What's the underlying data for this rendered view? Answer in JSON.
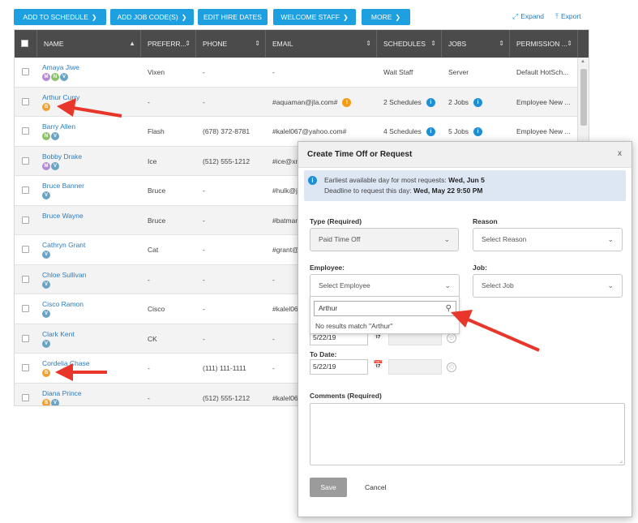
{
  "toolbar": {
    "add_to_schedule": "ADD TO SCHEDULE",
    "add_job_codes": "ADD JOB CODE(S)",
    "edit_hire_dates": "EDIT HIRE DATES",
    "welcome_staff": "WELCOME STAFF",
    "more": "MORE",
    "expand": "Expand",
    "export": "Export"
  },
  "grid": {
    "headers": {
      "name": "NAME",
      "preferred": "PREFERR...",
      "phone": "PHONE",
      "email": "EMAIL",
      "schedules": "SCHEDULES",
      "jobs": "JOBS",
      "permission": "PERMISSION ..."
    },
    "rows": [
      {
        "name": "Amaya Jiwe",
        "badges": [
          "M",
          "N",
          "V"
        ],
        "preferred": "Vixen",
        "phone": "-",
        "email": "-",
        "schedules": "Wait Staff",
        "jobs": "Server",
        "permission": "Default HotSch..."
      },
      {
        "name": "Arthur Curry",
        "badges": [
          "B"
        ],
        "preferred": "-",
        "phone": "-",
        "email": "#aquaman@jla.com#",
        "schedules": "2 Schedules",
        "jobs": "2 Jobs",
        "permission": "Employee New ..."
      },
      {
        "name": "Barry Allen",
        "badges": [
          "N",
          "V"
        ],
        "preferred": "Flash",
        "phone": "(678) 372-8781",
        "email": "#kalel067@yahoo.com#",
        "schedules": "4 Schedules",
        "jobs": "5 Jobs",
        "permission": "Employee New ..."
      },
      {
        "name": "Bobby Drake",
        "badges": [
          "M",
          "V"
        ],
        "preferred": "Ice",
        "phone": "(512) 555-1212",
        "email": "#ice@xn",
        "schedules": "",
        "jobs": "",
        "permission": ""
      },
      {
        "name": "Bruce Banner",
        "badges": [
          "V"
        ],
        "preferred": "Bruce",
        "phone": "-",
        "email": "#hulk@j",
        "schedules": "",
        "jobs": "",
        "permission": ""
      },
      {
        "name": "Bruce Wayne",
        "badges": [],
        "preferred": "Bruce",
        "phone": "-",
        "email": "#batmar",
        "schedules": "",
        "jobs": "",
        "permission": ""
      },
      {
        "name": "Cathryn Grant",
        "badges": [
          "V"
        ],
        "preferred": "Cat",
        "phone": "-",
        "email": "#grant@",
        "schedules": "",
        "jobs": "",
        "permission": ""
      },
      {
        "name": "Chloe Sullivan",
        "badges": [
          "V"
        ],
        "preferred": "-",
        "phone": "-",
        "email": "-",
        "schedules": "",
        "jobs": "",
        "permission": ""
      },
      {
        "name": "Cisco Ramon",
        "badges": [
          "V"
        ],
        "preferred": "Cisco",
        "phone": "-",
        "email": "#kalel06",
        "schedules": "",
        "jobs": "",
        "permission": ""
      },
      {
        "name": "Clark Kent",
        "badges": [
          "V"
        ],
        "preferred": "CK",
        "phone": "-",
        "email": "-",
        "schedules": "",
        "jobs": "",
        "permission": ""
      },
      {
        "name": "Cordelia Chase",
        "badges": [
          "B"
        ],
        "preferred": "-",
        "phone": "(111) 111-1111",
        "email": "-",
        "schedules": "",
        "jobs": "",
        "permission": ""
      },
      {
        "name": "Diana Prince",
        "badges": [
          "B",
          "V"
        ],
        "preferred": "-",
        "phone": "(512) 555-1212",
        "email": "#kalel06",
        "schedules": "",
        "jobs": "",
        "permission": ""
      }
    ]
  },
  "badge_colors": {
    "M": "#b48ad6",
    "N": "#8cc26a",
    "V": "#6aa3c4",
    "B": "#f0a030"
  },
  "modal": {
    "title": "Create Time Off or Request",
    "close": "x",
    "notice_line1_prefix": "Earliest available day for most requests:",
    "notice_line1_value": "Wed, Jun 5",
    "notice_line2_prefix": "Deadline to request this day:",
    "notice_line2_value": "Wed, May 22 9:50 PM",
    "type_label": "Type (Required)",
    "type_value": "Paid Time Off",
    "reason_label": "Reason",
    "reason_placeholder": "Select Reason",
    "employee_label": "Employee:",
    "employee_placeholder": "Select Employee",
    "job_label": "Job:",
    "job_placeholder": "Select Job",
    "search_value": "Arthur",
    "no_results": "No results match \"Arthur\"",
    "from_date": "5/22/19",
    "to_label": "To Date:",
    "to_date": "5/22/19",
    "comments_label": "Comments (Required)",
    "save": "Save",
    "cancel": "Cancel"
  },
  "accent_color": "#1e9fe0",
  "annotation_color": "#e8362a"
}
